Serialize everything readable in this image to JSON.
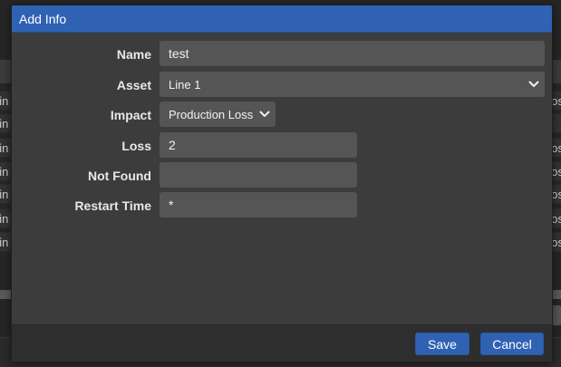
{
  "background": {
    "rows": [
      {
        "left": "Lin",
        "right": "os"
      },
      {
        "left": "Lin",
        "right": ""
      },
      {
        "left": "Lin",
        "right": "os"
      },
      {
        "left": "Lin",
        "right": "os"
      },
      {
        "left": "Lin",
        "right": "os"
      },
      {
        "left": "Lin",
        "right": "os"
      },
      {
        "left": "Lin",
        "right": "os"
      }
    ]
  },
  "modal": {
    "title": "Add Info",
    "fields": {
      "name": {
        "label": "Name",
        "value": "test"
      },
      "asset": {
        "label": "Asset",
        "value": "Line 1"
      },
      "impact": {
        "label": "Impact",
        "value": "Production Loss"
      },
      "loss": {
        "label": "Loss",
        "value": "2"
      },
      "not_found": {
        "label": "Not Found",
        "value": ""
      },
      "restart_time": {
        "label": "Restart Time",
        "value": "*"
      }
    },
    "footer": {
      "save_label": "Save",
      "cancel_label": "Cancel"
    }
  },
  "colors": {
    "accent": "#2f62b3",
    "modal_bg": "#3c3c3c",
    "input_bg": "#555555"
  }
}
